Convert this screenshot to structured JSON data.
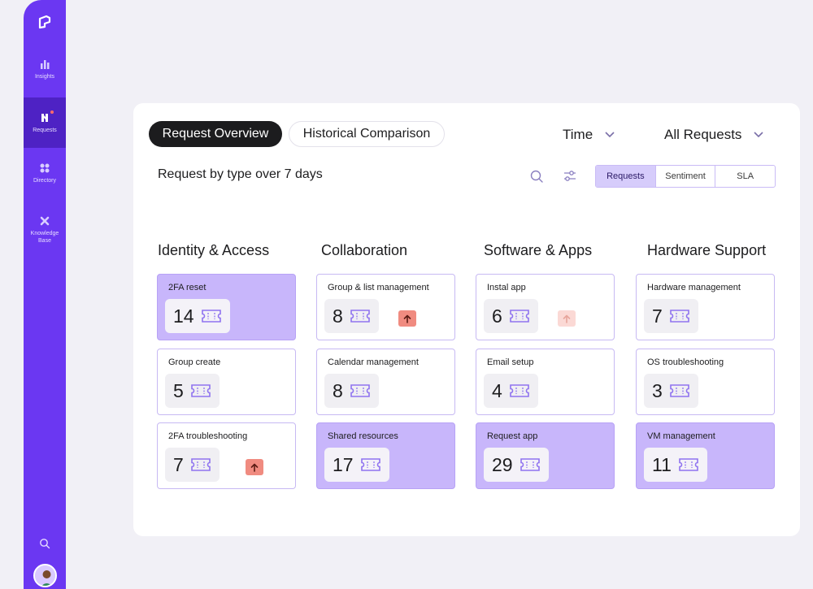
{
  "sidebar": {
    "items": [
      {
        "label": "Insights",
        "icon": "bar-chart-icon"
      },
      {
        "label": "Requests",
        "icon": "requests-icon"
      },
      {
        "label": "Directory",
        "icon": "grid-icon"
      },
      {
        "label": "Knowledge Base",
        "icon": "x-cross-icon"
      }
    ]
  },
  "tabs": {
    "active": "Request Overview",
    "inactive": "Historical Comparison"
  },
  "filters": {
    "time": "Time",
    "requests": "All Requests"
  },
  "subtitle": "Request by type over 7 days",
  "segments": [
    "Requests",
    "Sentiment",
    "SLA"
  ],
  "columns": [
    {
      "title": "Identity & Access",
      "cards": [
        {
          "title": "2FA reset",
          "count": "14",
          "highlight": true,
          "badge": ""
        },
        {
          "title": "Group create",
          "count": "5",
          "highlight": false,
          "badge": ""
        },
        {
          "title": "2FA troubleshooting",
          "count": "7",
          "highlight": false,
          "badge": "strong"
        }
      ]
    },
    {
      "title": "Collaboration",
      "cards": [
        {
          "title": "Group & list management",
          "count": "8",
          "highlight": false,
          "badge": "strong"
        },
        {
          "title": "Calendar management",
          "count": "8",
          "highlight": false,
          "badge": ""
        },
        {
          "title": "Shared resources",
          "count": "17",
          "highlight": true,
          "badge": ""
        }
      ]
    },
    {
      "title": "Software & Apps",
      "cards": [
        {
          "title": "Instal app",
          "count": "6",
          "highlight": false,
          "badge": "faint"
        },
        {
          "title": "Email setup",
          "count": "4",
          "highlight": false,
          "badge": ""
        },
        {
          "title": "Request app",
          "count": "29",
          "highlight": true,
          "badge": ""
        }
      ]
    },
    {
      "title": "Hardware Support",
      "cards": [
        {
          "title": "Hardware management",
          "count": "7",
          "highlight": false,
          "badge": ""
        },
        {
          "title": "OS troubleshooting",
          "count": "3",
          "highlight": false,
          "badge": ""
        },
        {
          "title": "VM management",
          "count": "11",
          "highlight": true,
          "badge": ""
        }
      ]
    }
  ],
  "colors": {
    "accent": "#6b37f2",
    "highlight": "#c8b6fb",
    "badge": "#f08b80"
  }
}
